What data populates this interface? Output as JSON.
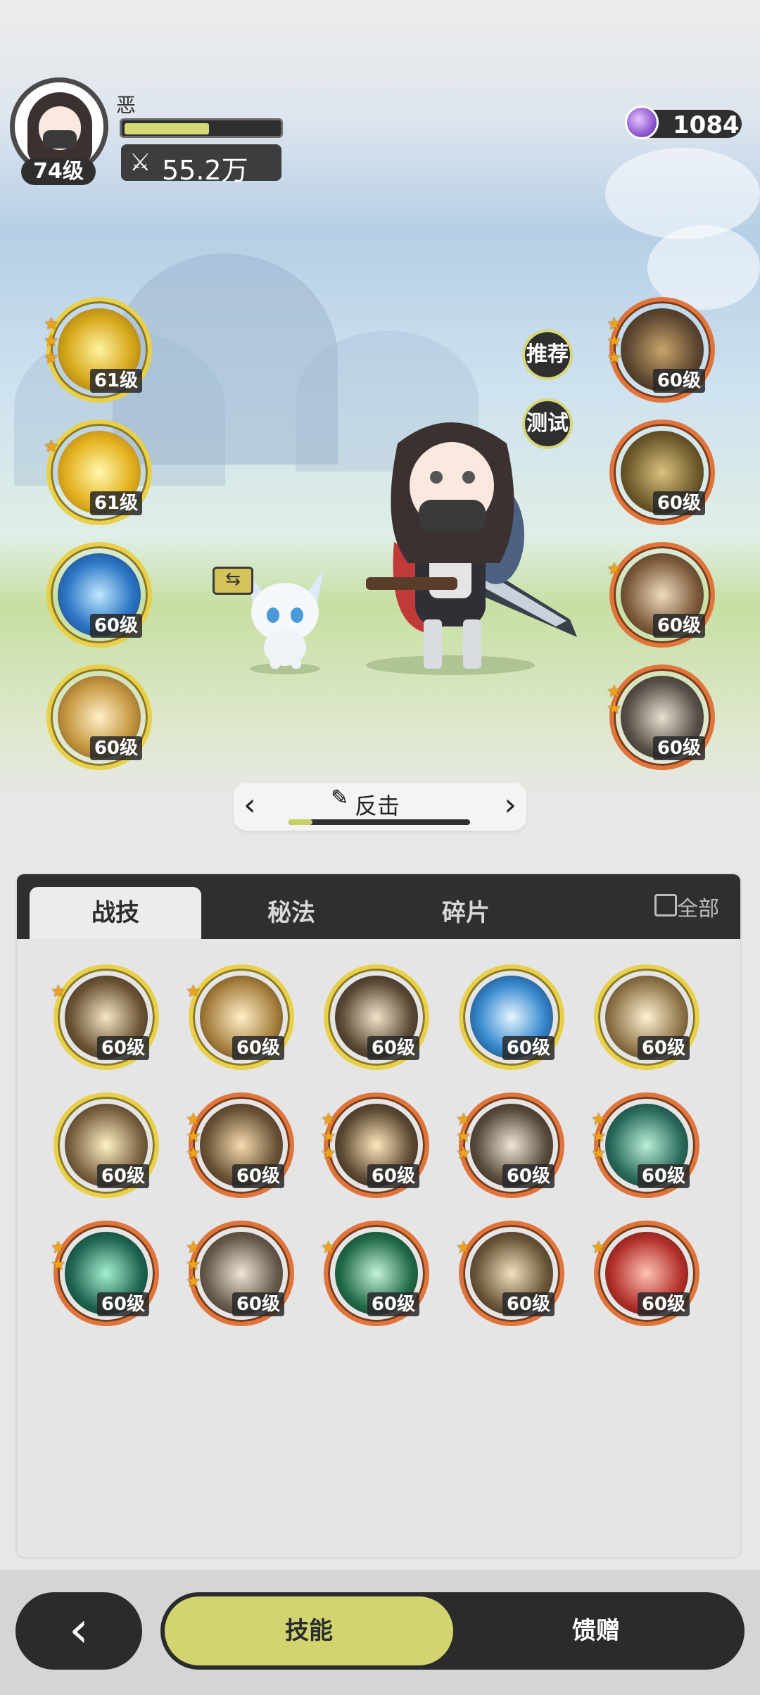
{
  "player": {
    "name": "恶",
    "level": "74级",
    "power": "55.2万",
    "exp_fraction": 0.55
  },
  "currency": {
    "amount": "1084",
    "icon": "purple-gem-icon"
  },
  "left_skills": [
    {
      "level": "61级",
      "stars": 3,
      "icon": "golden-diamond-up-icon"
    },
    {
      "level": "61级",
      "stars": 1,
      "icon": "golden-crystal-up-icon"
    },
    {
      "level": "60级",
      "stars": 0,
      "icon": "blue-ring-icon"
    },
    {
      "level": "60级",
      "stars": 0,
      "icon": "golden-blade-icon"
    }
  ],
  "right_skills": [
    {
      "level": "60级",
      "stars": 3,
      "icon": "fist-icon"
    },
    {
      "level": "60级",
      "stars": 0,
      "icon": "armored-figure-icon"
    },
    {
      "level": "60级",
      "stars": 1,
      "icon": "shield-heart-icon"
    },
    {
      "level": "60级",
      "stars": 2,
      "icon": "helmet-icon"
    }
  ],
  "side_buttons": {
    "recommend": "推荐",
    "test": "测试"
  },
  "stance": {
    "label": "反击",
    "progress": 0.13
  },
  "tabs": {
    "skills": "战技",
    "secrets": "秘法",
    "fragments": "碎片",
    "all": "全部"
  },
  "skill_grid": [
    {
      "level": "60级",
      "stars": 1,
      "ring": "gold"
    },
    {
      "level": "60级",
      "stars": 1,
      "ring": "gold"
    },
    {
      "level": "60级",
      "stars": 0,
      "ring": "gold"
    },
    {
      "level": "60级",
      "stars": 0,
      "ring": "gold"
    },
    {
      "level": "60级",
      "stars": 0,
      "ring": "gold"
    },
    {
      "level": "60级",
      "stars": 0,
      "ring": "gold"
    },
    {
      "level": "60级",
      "stars": 3,
      "ring": "orange"
    },
    {
      "level": "60级",
      "stars": 3,
      "ring": "orange"
    },
    {
      "level": "60级",
      "stars": 3,
      "ring": "orange"
    },
    {
      "level": "60级",
      "stars": 3,
      "ring": "orange"
    },
    {
      "level": "60级",
      "stars": 2,
      "ring": "orange"
    },
    {
      "level": "60级",
      "stars": 3,
      "ring": "orange"
    },
    {
      "level": "60级",
      "stars": 1,
      "ring": "orange"
    },
    {
      "level": "60级",
      "stars": 1,
      "ring": "orange"
    },
    {
      "level": "60级",
      "stars": 1,
      "ring": "orange"
    }
  ],
  "bottom_nav": {
    "skills": "技能",
    "gifts": "馈赠"
  }
}
